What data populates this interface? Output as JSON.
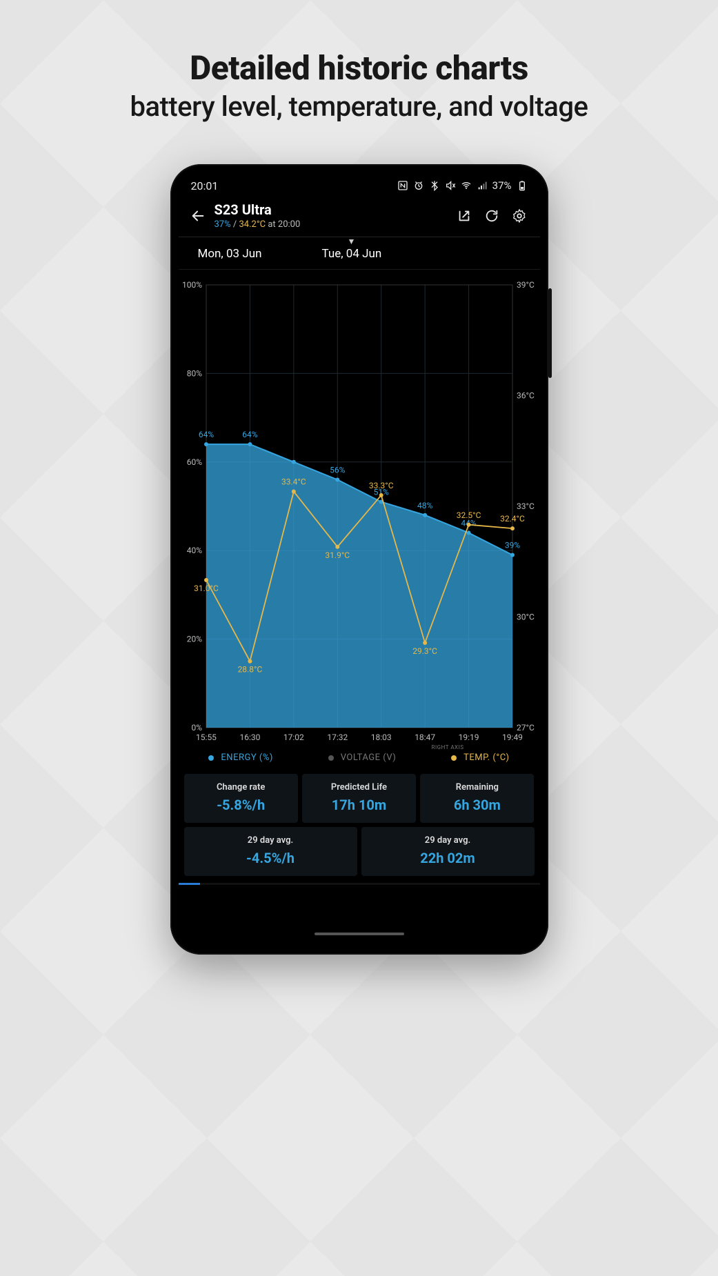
{
  "marketing": {
    "title": "Detailed historic charts",
    "subtitle": "battery level, temperature, and voltage"
  },
  "statusbar": {
    "time": "20:01",
    "battery_text": "37%"
  },
  "appbar": {
    "title": "S23 Ultra",
    "sub_percent": "37%",
    "sub_sep": " / ",
    "sub_temp": "34.2°C",
    "sub_tail": " at 20:00"
  },
  "tabs": {
    "left": "Mon, 03 Jun",
    "right": "Tue, 04 Jun"
  },
  "legend": {
    "right_axis": "RIGHT AXIS",
    "energy": "ENERGY (%)",
    "voltage": "VOLTAGE (V)",
    "temp": "TEMP. (°C)"
  },
  "cards_top": [
    {
      "k": "Change rate",
      "v": "-5.8%/h"
    },
    {
      "k": "Predicted Life",
      "v": "17h 10m"
    },
    {
      "k": "Remaining",
      "v": "6h 30m"
    }
  ],
  "cards_bottom": [
    {
      "k": "29 day avg.",
      "v": "-4.5%/h"
    },
    {
      "k": "29 day avg.",
      "v": "22h 02m"
    }
  ],
  "chart_data": {
    "type": "line",
    "title": "",
    "x_ticks": [
      "15:55",
      "16:30",
      "17:02",
      "17:32",
      "18:03",
      "18:47",
      "19:19",
      "19:49"
    ],
    "y_left": {
      "label": "",
      "ticks_pct": [
        0,
        20,
        40,
        60,
        80,
        100
      ],
      "ylim": [
        0,
        100
      ]
    },
    "y_right": {
      "label": "",
      "ticks_c": [
        27,
        30,
        33,
        36,
        39
      ],
      "ylim": [
        27,
        39
      ]
    },
    "series": [
      {
        "name": "ENERGY (%)",
        "axis": "left",
        "color": "#36a6e0",
        "style": "area",
        "points": [
          {
            "x": "15:55",
            "y": 64,
            "label": "64%"
          },
          {
            "x": "16:30",
            "y": 64,
            "label": "64%"
          },
          {
            "x": "17:02",
            "y": 60
          },
          {
            "x": "17:32",
            "y": 56,
            "label": "56%"
          },
          {
            "x": "18:03",
            "y": 51,
            "label": "51%"
          },
          {
            "x": "18:47",
            "y": 48,
            "label": "48%"
          },
          {
            "x": "19:19",
            "y": 44,
            "label": "44%"
          },
          {
            "x": "19:49",
            "y": 39,
            "label": "39%"
          }
        ]
      },
      {
        "name": "TEMP. (°C)",
        "axis": "right",
        "color": "#e6b84a",
        "style": "line",
        "points": [
          {
            "x": "15:55",
            "y": 31.0,
            "label": "31.0°C"
          },
          {
            "x": "16:30",
            "y": 28.8,
            "label": "28.8°C"
          },
          {
            "x": "17:02",
            "y": 33.4,
            "label": "33.4°C"
          },
          {
            "x": "17:32",
            "y": 31.9,
            "label": "31.9°C"
          },
          {
            "x": "18:03",
            "y": 33.3,
            "label": "33.3°C"
          },
          {
            "x": "18:47",
            "y": 29.3,
            "label": "29.3°C"
          },
          {
            "x": "19:19",
            "y": 32.5,
            "label": "32.5°C"
          },
          {
            "x": "19:49",
            "y": 32.4,
            "label": "32.4°C"
          }
        ]
      }
    ]
  }
}
